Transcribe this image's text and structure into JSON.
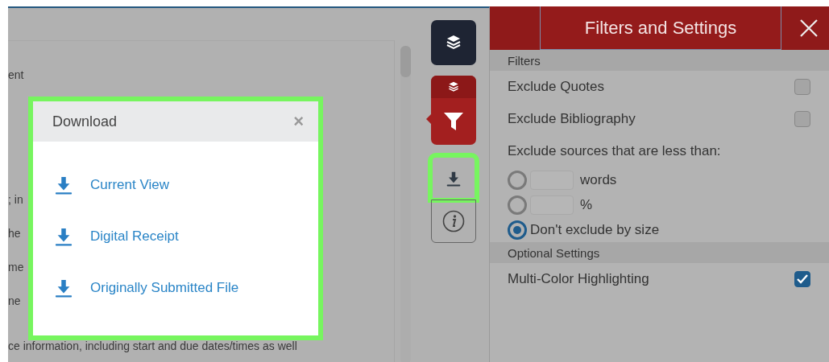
{
  "document": {
    "lines": [
      "ent",
      "; in",
      "he",
      "me",
      "ne",
      "ce information, including start and due dates/times as well"
    ]
  },
  "download_dialog": {
    "title": "Download",
    "close": "×",
    "items": [
      "Current View",
      "Digital Receipt",
      "Originally Submitted File"
    ]
  },
  "toolbar": [
    {
      "kind": "layers",
      "highlighted": false
    },
    {
      "kind": "filter",
      "highlighted": false
    },
    {
      "kind": "download",
      "highlighted": true
    },
    {
      "kind": "info",
      "highlighted": false
    }
  ],
  "panel": {
    "title": "Filters and Settings",
    "sections": [
      {
        "heading": "Filters",
        "options": [
          {
            "kind": "checkbox",
            "label": "Exclude Quotes",
            "checked": false
          },
          {
            "kind": "checkbox",
            "label": "Exclude Bibliography",
            "checked": false
          },
          {
            "kind": "text",
            "label": "Exclude sources that are less than:"
          },
          {
            "kind": "radio-field",
            "label": "words",
            "selected": false
          },
          {
            "kind": "radio-field",
            "label": "%",
            "selected": false
          },
          {
            "kind": "radio",
            "label": "Don't exclude by size",
            "selected": true
          }
        ]
      },
      {
        "heading": "Optional Settings",
        "options": [
          {
            "kind": "checkbox",
            "label": "Multi-Color Highlighting",
            "checked": true
          }
        ]
      }
    ]
  }
}
